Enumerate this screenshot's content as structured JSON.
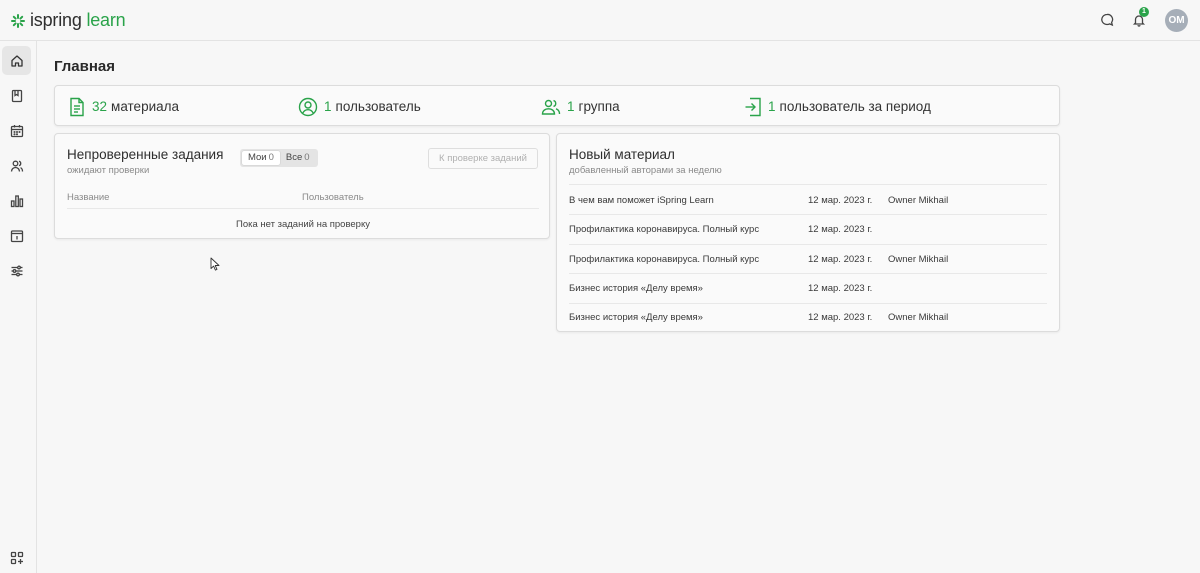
{
  "app": {
    "logo_prefix": "ispring",
    "logo_suffix": "learn",
    "brand_color": "#2aa34a"
  },
  "header": {
    "notification_count": "1",
    "avatar_initials": "OM"
  },
  "sidebar": {
    "items": [
      {
        "icon": "home-icon",
        "active": true
      },
      {
        "icon": "book-icon",
        "active": false
      },
      {
        "icon": "calendar-icon",
        "active": false
      },
      {
        "icon": "users-icon",
        "active": false
      },
      {
        "icon": "reports-icon",
        "active": false
      },
      {
        "icon": "task-icon",
        "active": false
      },
      {
        "icon": "settings-sliders-icon",
        "active": false
      }
    ],
    "bottom_icon": "add-apps-icon"
  },
  "page": {
    "title": "Главная"
  },
  "stats": [
    {
      "icon": "document-icon",
      "num": "32",
      "label": "материала"
    },
    {
      "icon": "user-circle-icon",
      "num": "1",
      "label": "пользователь"
    },
    {
      "icon": "group-icon",
      "num": "1",
      "label": "группа"
    },
    {
      "icon": "login-icon",
      "num": "1",
      "label": "пользователь за период"
    }
  ],
  "unchecked": {
    "title": "Непроверенные задания",
    "subtitle": "ожидают проверки",
    "tabs": [
      {
        "label": "Мои",
        "count": "0"
      },
      {
        "label": "Все",
        "count": "0"
      }
    ],
    "review_button": "К проверке заданий",
    "columns": [
      "Название",
      "Пользователь"
    ],
    "empty_text": "Пока нет заданий на проверку"
  },
  "new_material": {
    "title": "Новый материал",
    "subtitle": "добавленный авторами за неделю",
    "rows": [
      {
        "name": "В чем вам поможет iSpring Learn",
        "date": "12 мар. 2023 г.",
        "author": "Owner Mikhail"
      },
      {
        "name": "Профилактика коронавируса. Полный курс",
        "date": "12 мар. 2023 г.",
        "author": ""
      },
      {
        "name": "Профилактика коронавируса. Полный курс",
        "date": "12 мар. 2023 г.",
        "author": "Owner Mikhail"
      },
      {
        "name": "Бизнес история «Делу время»",
        "date": "12 мар. 2023 г.",
        "author": ""
      },
      {
        "name": "Бизнес история «Делу время»",
        "date": "12 мар. 2023 г.",
        "author": "Owner Mikhail"
      }
    ]
  }
}
